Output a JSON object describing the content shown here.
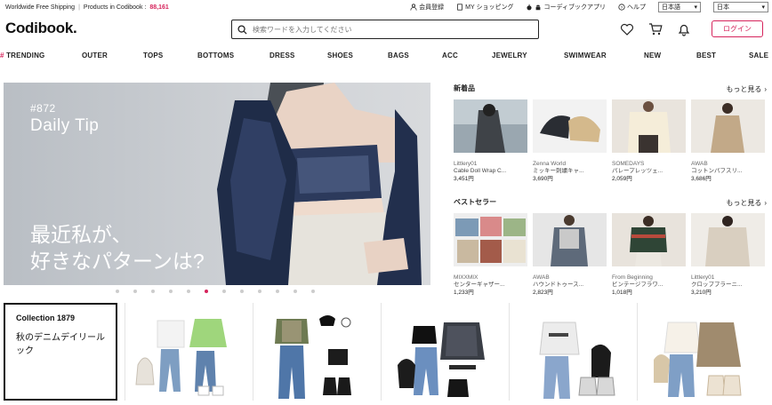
{
  "topbar": {
    "shipping": "Worldwide Free Shipping",
    "products_label": "Products in Codibook :",
    "products_count": "88,161",
    "signup": "会員登録",
    "my_shopping": "MY ショッピング",
    "app": "コーディブックアプリ",
    "help": "ヘルプ",
    "language": "日本語",
    "country": "日本"
  },
  "header": {
    "logo": "Codibook.",
    "search_placeholder": "検索ワードを入力してください",
    "login": "ログイン"
  },
  "categories": [
    "TRENDING",
    "OUTER",
    "TOPS",
    "BOTTOMS",
    "DRESS",
    "SHOES",
    "BAGS",
    "ACC",
    "JEWELRY",
    "SWIMWEAR",
    "NEW",
    "BEST",
    "SALE"
  ],
  "hero": {
    "number": "#872",
    "title": "Daily Tip",
    "line1": "最近私が、",
    "line2": "好きなパターンは?"
  },
  "new_items": {
    "title": "新着品",
    "more": "もっと見る",
    "items": [
      {
        "brand": "Littlery01",
        "name": "Cable Doll Wrap C...",
        "price": "3,451円"
      },
      {
        "brand": "Zenna World",
        "name": "ミッキー刺繍キャ...",
        "price": "3,690円"
      },
      {
        "brand": "SOMEDAYS",
        "name": "パレープレッツェ...",
        "price": "2,059円"
      },
      {
        "brand": "AWAB",
        "name": "コットンパフスリ...",
        "price": "3,686円"
      }
    ]
  },
  "best_sellers": {
    "title": "ベストセラー",
    "more": "もっと見る",
    "items": [
      {
        "brand": "MIXXMIX",
        "name": "センターギャザー...",
        "price": "1,233円"
      },
      {
        "brand": "AWAB",
        "name": "ハウンドトゥース...",
        "price": "2,823円"
      },
      {
        "brand": "From Beginning",
        "name": "ビンテージフラワ...",
        "price": "1,018円"
      },
      {
        "brand": "Littlery01",
        "name": "クロップブラーニ...",
        "price": "3,210円"
      }
    ]
  },
  "collection": {
    "title": "Collection 1879",
    "name": "秋のデニムデイリールック"
  },
  "colors": {
    "accent": "#d6245c"
  }
}
